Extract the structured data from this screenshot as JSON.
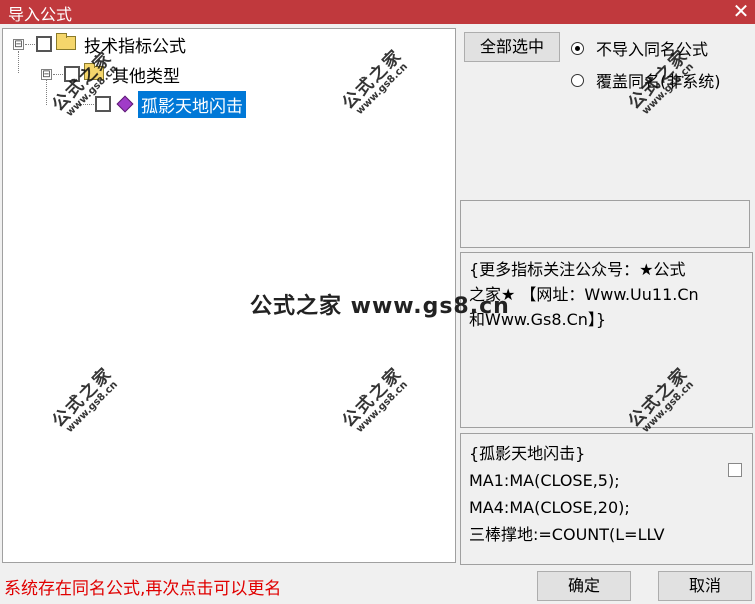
{
  "window": {
    "title": "导入公式",
    "close_glyph": "✕"
  },
  "tree": {
    "nodes": [
      {
        "label": "技术指标公式",
        "icon": "folder-icon",
        "expander": "⊟"
      },
      {
        "label": "其他类型",
        "icon": "folder-icon",
        "expander": "⊟"
      },
      {
        "label": "孤影天地闪击",
        "icon": "formula-icon",
        "selected": true
      }
    ]
  },
  "controls": {
    "select_all_label": "全部选中",
    "radio_options": [
      {
        "label": "不导入同名公式",
        "checked": true
      },
      {
        "label": "覆盖同名(非系统)",
        "checked": false
      }
    ],
    "ok_label": "确定",
    "cancel_label": "取消"
  },
  "description": {
    "lines": [
      "{更多指标关注公众号：★公式",
      "之家★ 【网址：Www.Uu11.Cn",
      "和Www.Gs8.Cn】}"
    ]
  },
  "code": {
    "lines": [
      "{孤影天地闪击}",
      "MA1:MA(CLOSE,5);",
      "MA4:MA(CLOSE,20);",
      "三棒撑地:=COUNT(L=LLV"
    ]
  },
  "status": {
    "message": "系统存在同名公式,再次点击可以更名"
  },
  "watermark": {
    "main": "公式之家",
    "sub": "www.gs8.cn",
    "center": "公式之家 www.gs8.cn"
  },
  "colors": {
    "titlebar": "#c0393d",
    "selection": "#0078d7",
    "status_text": "#e00000"
  }
}
